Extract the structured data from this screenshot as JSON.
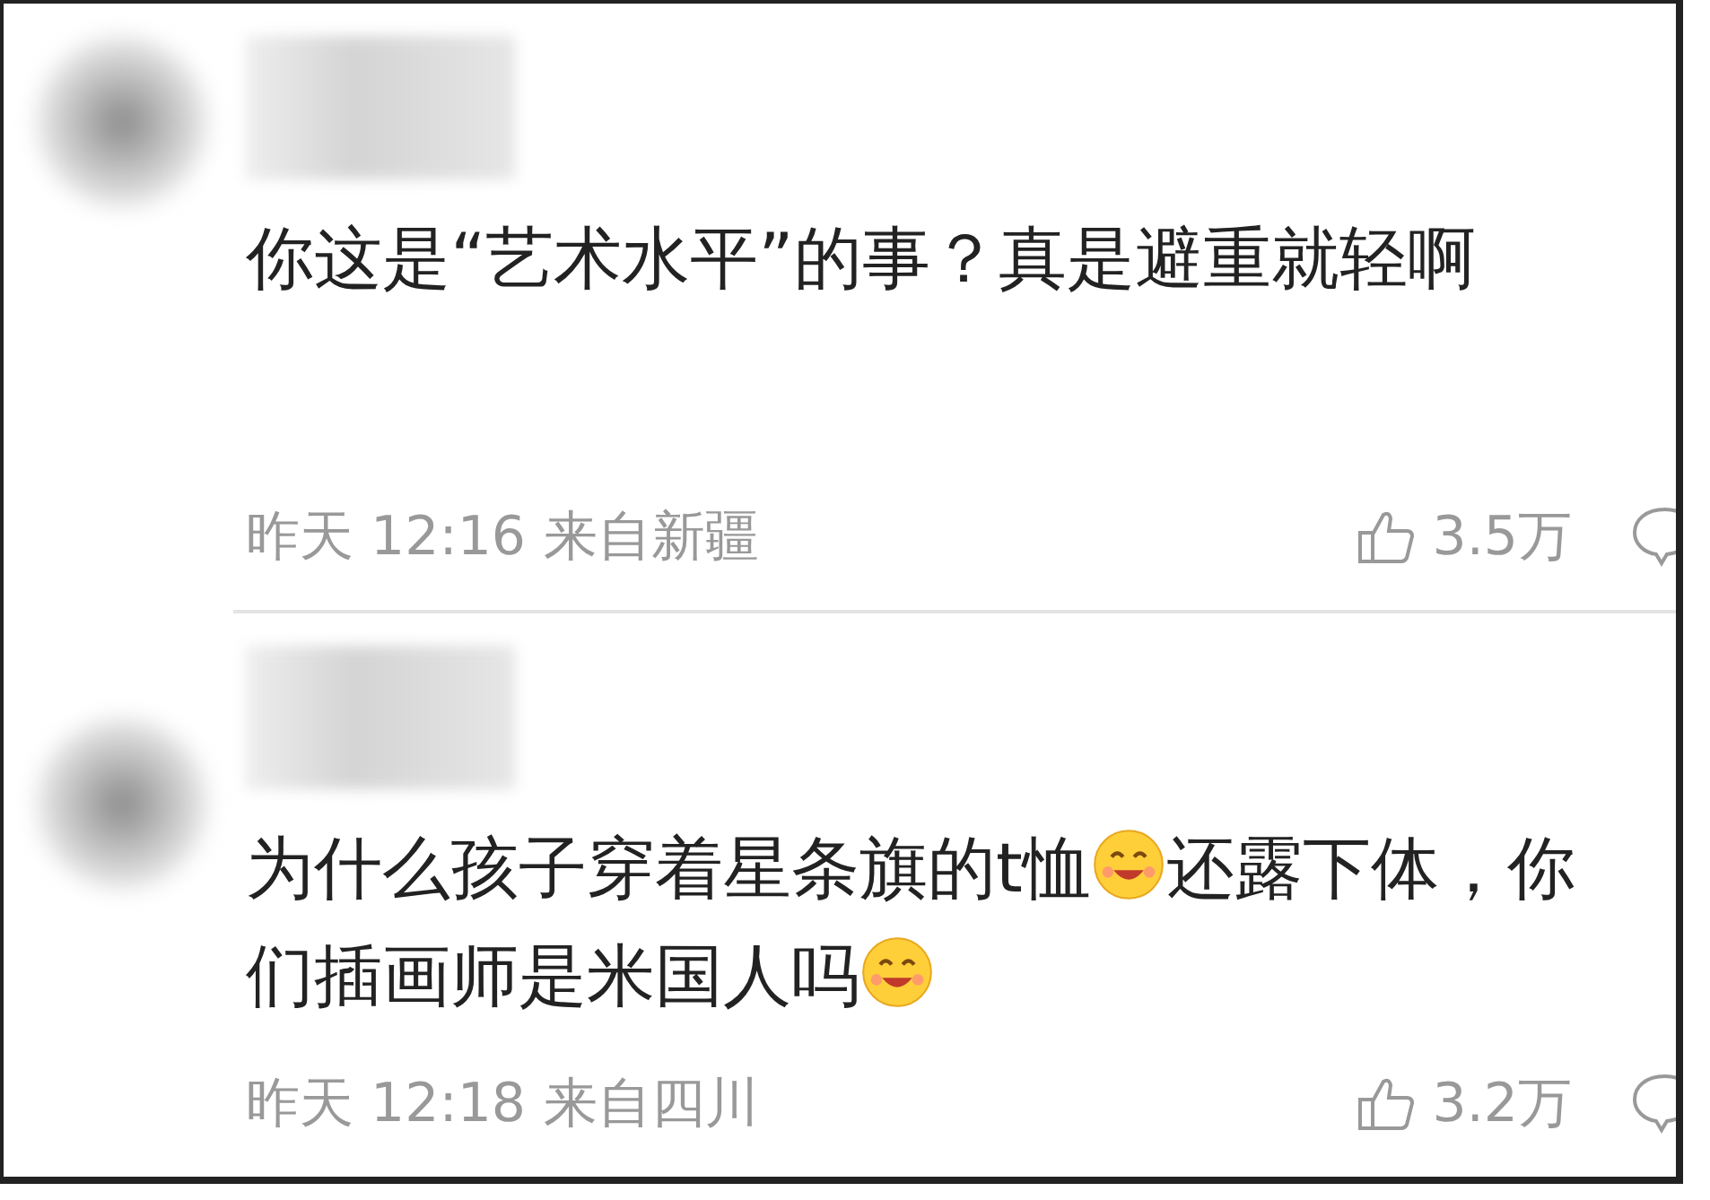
{
  "comments": [
    {
      "text": [
        {
          "kind": "text",
          "value": "你这是“艺术水平”的事？真是避重就轻啊"
        }
      ],
      "time": "昨天 12:16",
      "location": "来自新疆",
      "likes": "3.5万"
    },
    {
      "text": [
        {
          "kind": "text",
          "value": "为什么孩子穿着星条旗的t恤"
        },
        {
          "kind": "emoji"
        },
        {
          "kind": "text",
          "value": "还露下体，你们插画师是米国人吗"
        },
        {
          "kind": "emoji"
        }
      ],
      "time": "昨天 12:18",
      "location": "来自四川",
      "likes": "3.2万"
    }
  ]
}
